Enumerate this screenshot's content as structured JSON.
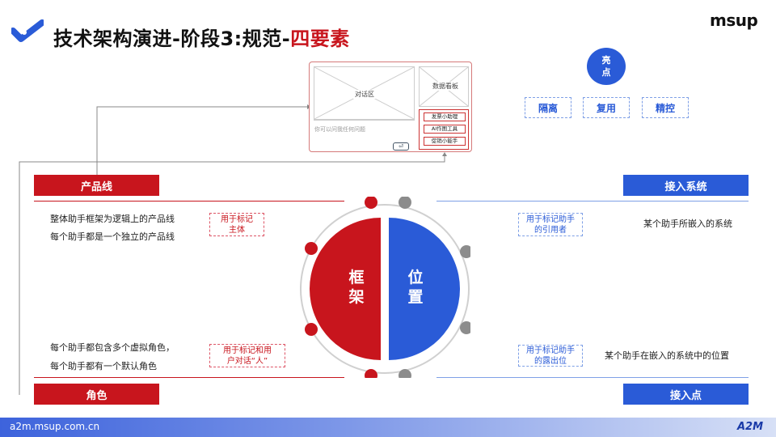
{
  "title": {
    "main": "技术架构演进-阶段3:规范-",
    "accent": "四要素"
  },
  "brand": "msup",
  "wireframe": {
    "dialog_label": "对话区",
    "board_label": "数据看板",
    "input_placeholder": "你可以问我任何问题",
    "send_glyph": "⏎",
    "tools": [
      "发票小助理",
      "AI作图工具",
      "促销小能手"
    ]
  },
  "highlights": {
    "circle_label": "亮\n点",
    "tags": [
      "隔离",
      "复用",
      "精控"
    ]
  },
  "sections": {
    "product_line": "产品线",
    "role": "角色",
    "access_system": "接入系统",
    "access_point": "接入点"
  },
  "left_texts": {
    "product_1": "整体助手框架为逻辑上的产品线",
    "product_2": "每个助手都是一个独立的产品线",
    "role_1": "每个助手都包含多个虚拟角色，",
    "role_2": "每个助手都有一个默认角色"
  },
  "notes": {
    "subject": "用于标记\n主体",
    "dialogue": "用于标记和用\n户对话“人”",
    "referrer": "用于标记助手\n的引用者",
    "exposure": "用于标记助手\n的露出位"
  },
  "right_texts": {
    "system": "某个助手所嵌入的系统",
    "position": "某个助手在嵌入的系统中的位置"
  },
  "center": {
    "left": "框架",
    "right": "位置"
  },
  "footer": {
    "url": "a2m.msup.com.cn",
    "logo": "A2M"
  },
  "colors": {
    "red": "#c8151d",
    "blue": "#2a5bd7",
    "gray": "#8c8c8c"
  }
}
